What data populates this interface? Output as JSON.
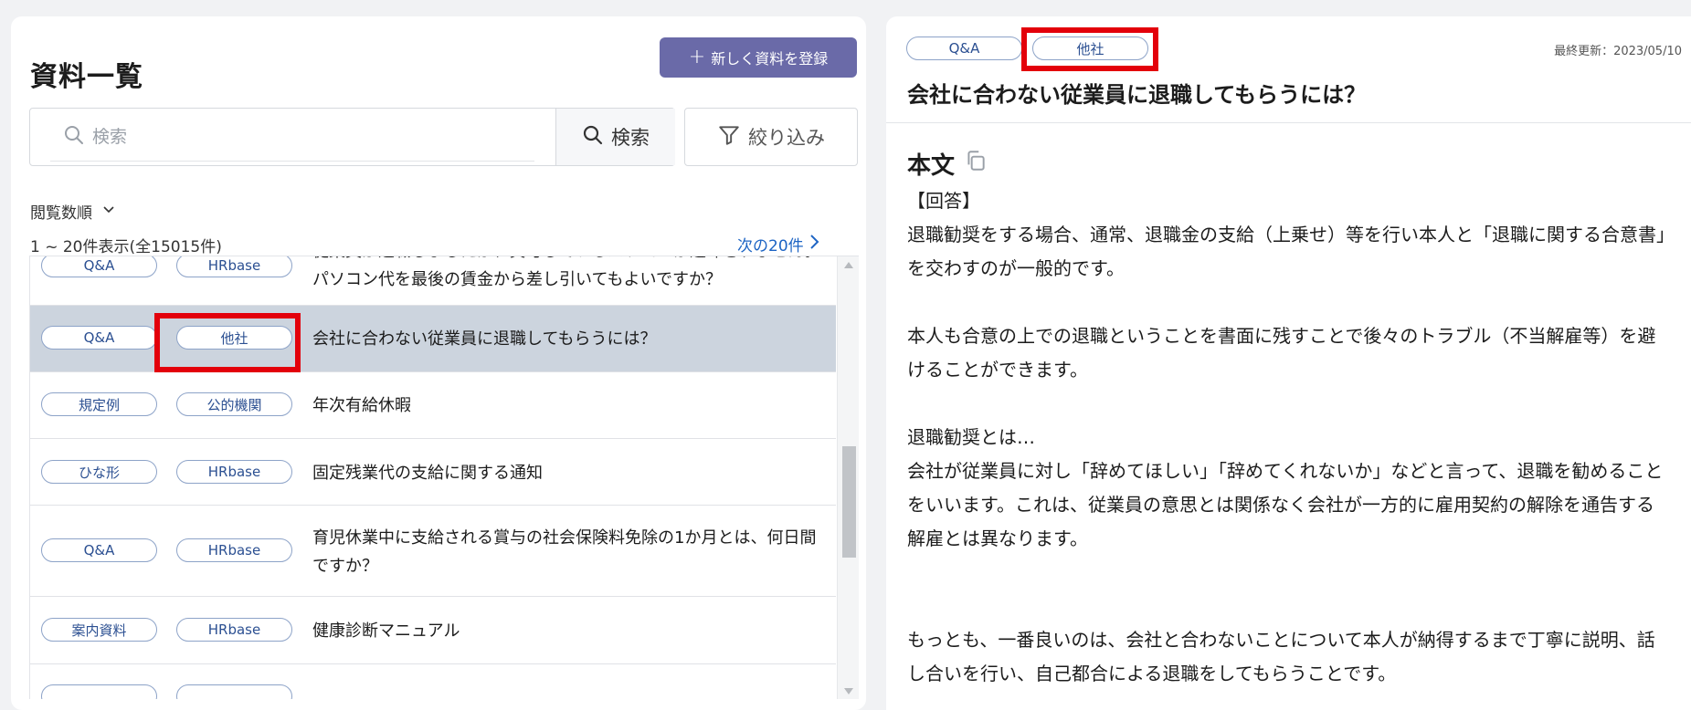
{
  "list_panel": {
    "title": "資料一覧",
    "new_button_label": "新しく資料を登録",
    "search": {
      "placeholder": "検索",
      "value": "",
      "button_label": "検索"
    },
    "filter_button_label": "絞り込み",
    "sort_label": "閲覧数順",
    "count_text": "1 ~ 20件表示(全15015件)",
    "next_link_label": "次の20件",
    "rows": [
      {
        "category": "Q&A",
        "source": "HRbase",
        "title": "従業員が退職しましたが、貸与しているパソコンが返却されません。パソコン代を最後の賃金から差し引いてもよいですか？"
      },
      {
        "category": "Q&A",
        "source": "他社",
        "title": "会社に合わない従業員に退職してもらうには？"
      },
      {
        "category": "規定例",
        "source": "公的機関",
        "title": "年次有給休暇"
      },
      {
        "category": "ひな形",
        "source": "HRbase",
        "title": "固定残業代の支給に関する通知"
      },
      {
        "category": "Q&A",
        "source": "HRbase",
        "title": "育児休業中に支給される賞与の社会保険料免除の1か月とは、何日間ですか？"
      },
      {
        "category": "案内資料",
        "source": "HRbase",
        "title": "健康診断マニュアル"
      }
    ]
  },
  "detail_panel": {
    "category_tag": "Q&A",
    "source_tag": "他社",
    "last_updated": "最終更新：2023/05/10",
    "title": "会社に合わない従業員に退職してもらうには？",
    "body_heading": "本文",
    "body_text": "【回答】\n退職勧奨をする場合、通常、退職金の支給（上乗せ）等を行い本人と「退職に関する合意書」を交わすのが一般的です。\n\n本人も合意の上での退職ということを書面に残すことで後々のトラブル（不当解雇等）を避けることができます。\n\n退職勧奨とは…\n会社が従業員に対し「辞めてほしい」「辞めてくれないか」などと言って、退職を勧めることをいいます。これは、従業員の意思とは関係なく会社が一方的に雇用契約の解除を通告する解雇とは異なります。\n\n\nもっとも、一番良いのは、会社と合わないことについて本人が納得するまで丁寧に説明、話し合いを行い、自己都合による退職をしてもらうことです。"
  },
  "colors": {
    "accent": "#6a6aa8",
    "link": "#1d64c4",
    "highlight": "#e3000b",
    "selected_row": "#ccd4de"
  }
}
